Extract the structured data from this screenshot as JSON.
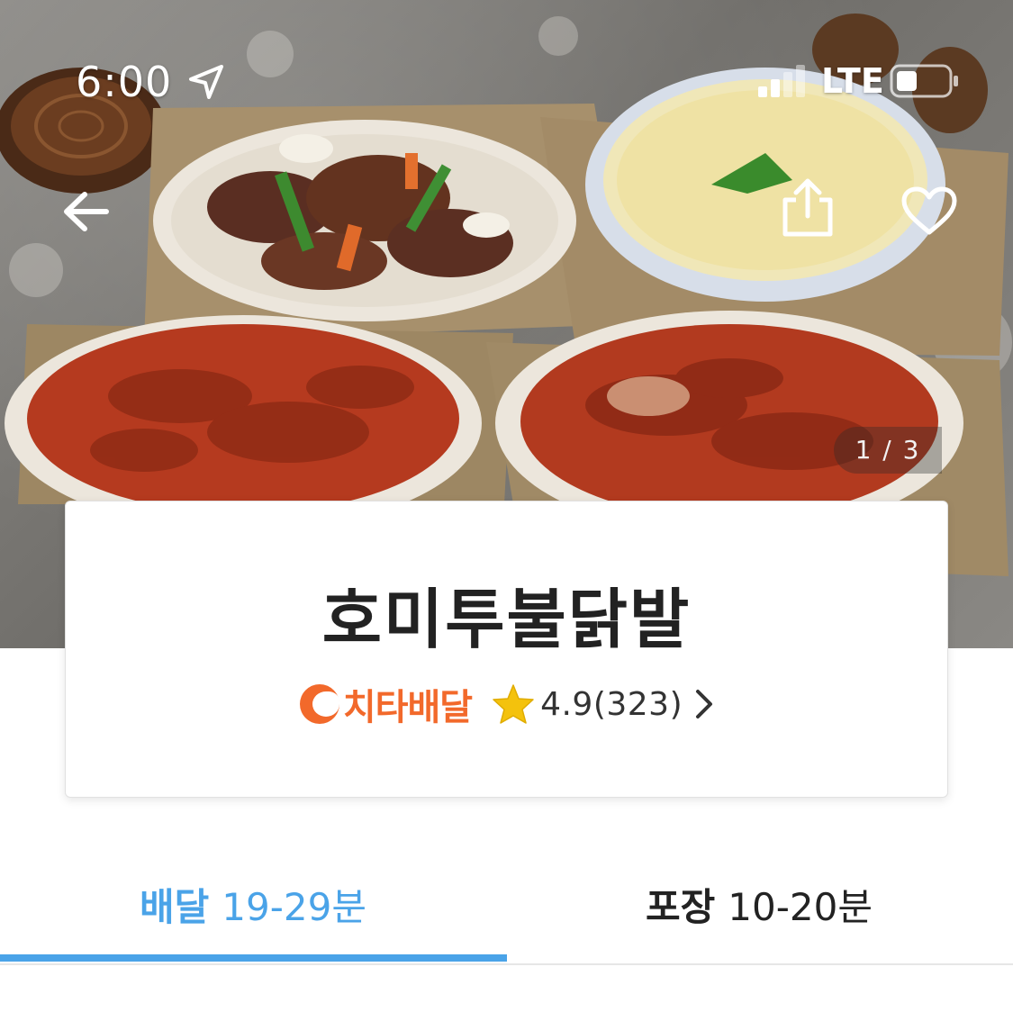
{
  "status_bar": {
    "time": "6:00",
    "network": "LTE",
    "location_icon": "location-arrow-icon",
    "signal_icon": "cellular-signal-icon",
    "battery_icon": "battery-icon"
  },
  "hero": {
    "back_icon": "arrow-left-icon",
    "share_icon": "share-icon",
    "favorite_icon": "heart-outline-icon",
    "photo_counter": "1 / 3"
  },
  "store": {
    "name": "호미투불닭발",
    "delivery_brand": "치타배달",
    "rating": "4.9(323)",
    "rating_icon": "star-icon",
    "rating_chevron_icon": "chevron-right-icon"
  },
  "tabs": [
    {
      "label": "배달",
      "time": "19-29분",
      "active": true
    },
    {
      "label": "포장",
      "time": "10-20분",
      "active": false
    }
  ],
  "colors": {
    "accent_blue": "#4aa3e8",
    "brand_orange": "#f2692b",
    "star_yellow": "#f4c20d",
    "text_dark": "#222222"
  }
}
